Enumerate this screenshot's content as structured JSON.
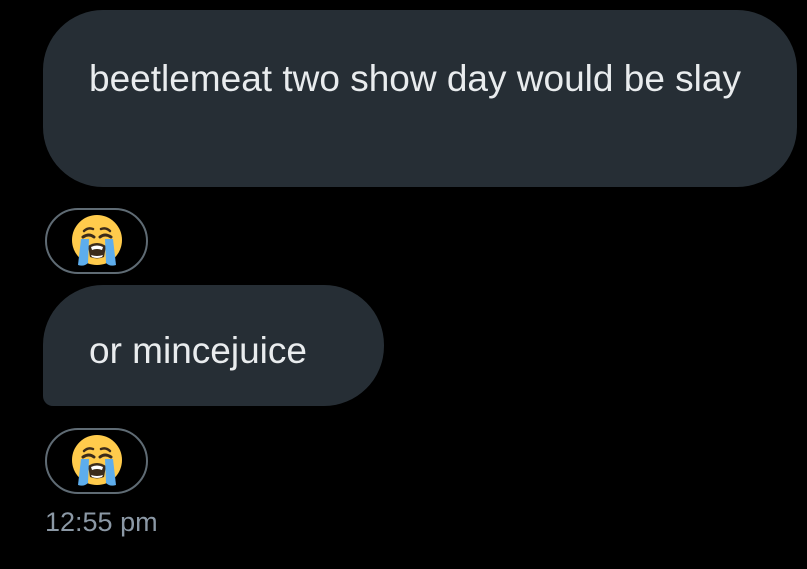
{
  "messages": [
    {
      "text": "beetlemeat two show day would be slay",
      "reaction": "loudly-crying-face-emoji"
    },
    {
      "text": "or mincejuice",
      "reaction": "loudly-crying-face-emoji"
    }
  ],
  "timestamp": "12:55 pm",
  "colors": {
    "background": "#000000",
    "bubble": "#262e35",
    "bubble_text": "#e9ecee",
    "reaction_border": "#5f6b74",
    "timestamp": "#8b98a5",
    "emoji_face": "#ffcb4c",
    "emoji_tears": "#5dadec"
  }
}
